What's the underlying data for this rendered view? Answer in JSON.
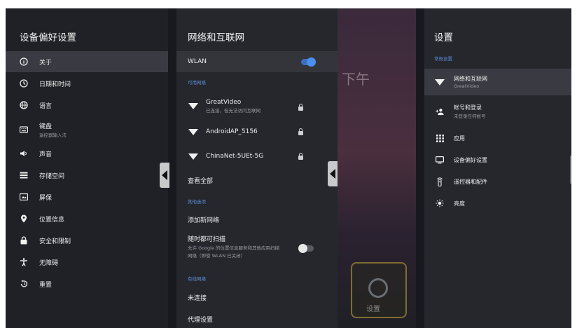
{
  "colors": {
    "accent": "#5b8fd6",
    "toggle_on": "#3b82f6"
  },
  "background": {
    "text_afternoon": "下午",
    "tile_label": "设置"
  },
  "left_panel": {
    "title": "设备偏好设置",
    "items": [
      {
        "label": "关于",
        "icon": "info-icon"
      },
      {
        "label": "日期和时间",
        "icon": "clock-icon"
      },
      {
        "label": "语言",
        "icon": "globe-icon"
      },
      {
        "label": "键盘",
        "sub": "遥控器输入法",
        "icon": "keyboard-icon"
      },
      {
        "label": "声音",
        "icon": "volume-icon"
      },
      {
        "label": "存储空间",
        "icon": "storage-icon"
      },
      {
        "label": "屏保",
        "icon": "screensaver-icon"
      },
      {
        "label": "位置信息",
        "icon": "location-icon"
      },
      {
        "label": "安全和限制",
        "icon": "lock-icon"
      },
      {
        "label": "无障碍",
        "icon": "accessibility-icon"
      },
      {
        "label": "重置",
        "icon": "reset-icon"
      }
    ]
  },
  "mid_panel": {
    "title": "网络和互联网",
    "wlan_label": "WLAN",
    "wlan_on": true,
    "available_header": "可用网络",
    "networks": [
      {
        "name": "GreatVideo",
        "status": "已连接，但无法访问互联网",
        "icon": "wifi-icon",
        "locked": true
      },
      {
        "name": "AndroidAP_5156",
        "status": "",
        "icon": "wifi-icon",
        "locked": true
      },
      {
        "name": "ChinaNet-5UEt-5G",
        "status": "",
        "icon": "wifi-icon",
        "locked": true
      }
    ],
    "see_all": "查看全部",
    "other_header": "其他选项",
    "add_network": "添加新网络",
    "scan_title": "随时都可扫描",
    "scan_desc_1": "允许 Google 的位置信息服务和其他应用扫描",
    "scan_desc_2": "网络（即使 WLAN 已关闭）",
    "scan_on": false,
    "wired_header": "有线网络",
    "not_connected": "未连接",
    "proxy": "代理设置"
  },
  "right_panel": {
    "title": "设置",
    "section": "常规设置",
    "items": [
      {
        "label": "网络和互联网",
        "sub": "GreatVideo",
        "icon": "wifi-icon"
      },
      {
        "label": "帐号和登录",
        "sub": "未登录任何帐号",
        "icon": "add-account-icon"
      },
      {
        "label": "应用",
        "icon": "apps-grid-icon"
      },
      {
        "label": "设备偏好设置",
        "icon": "tv-icon"
      },
      {
        "label": "遥控器和配件",
        "icon": "remote-icon"
      },
      {
        "label": "亮度",
        "icon": "brightness-icon"
      }
    ]
  }
}
